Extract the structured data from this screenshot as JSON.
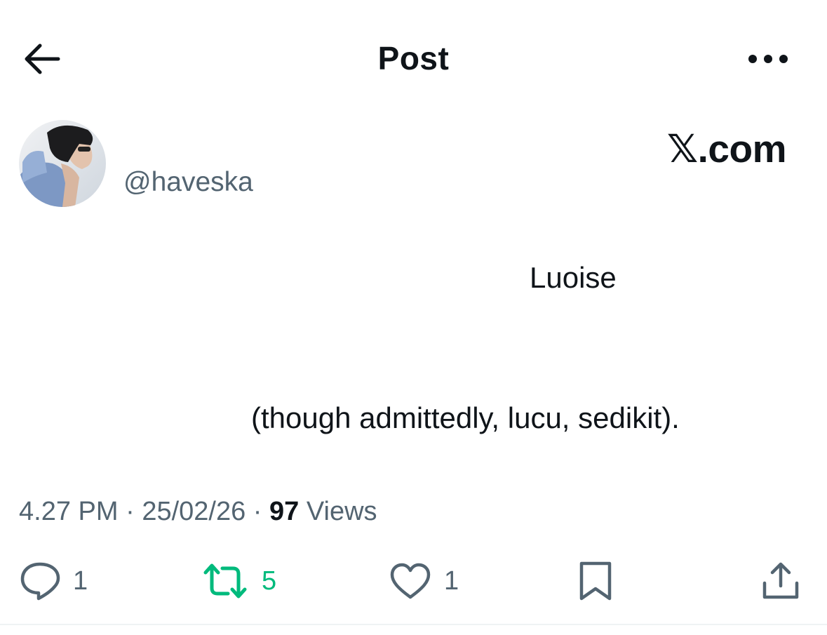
{
  "header": {
    "title": "Post",
    "back_icon": "arrow-left-icon",
    "more_icon": "more-horizontal-icon"
  },
  "author": {
    "handle": "@haveska"
  },
  "brand": {
    "text": "𝕏.com"
  },
  "tweet": {
    "line1": "Luoise",
    "line2": "(though admittedly, lucu, sedikit)."
  },
  "meta": {
    "time": "4.27 PM",
    "separator1": " · ",
    "date": "25/02/26",
    "separator2": " · ",
    "views_count": "97",
    "views_label": " Views"
  },
  "actions": {
    "reply_count": "1",
    "retweet_count": "5",
    "like_count": "1",
    "icons": [
      "reply-icon",
      "retweet-icon",
      "heart-icon",
      "bookmark-icon",
      "share-icon"
    ]
  },
  "colors": {
    "text_primary": "#0f1419",
    "text_secondary": "#536471",
    "retweet_green": "#00ba7c",
    "divider": "#eff3f4"
  }
}
